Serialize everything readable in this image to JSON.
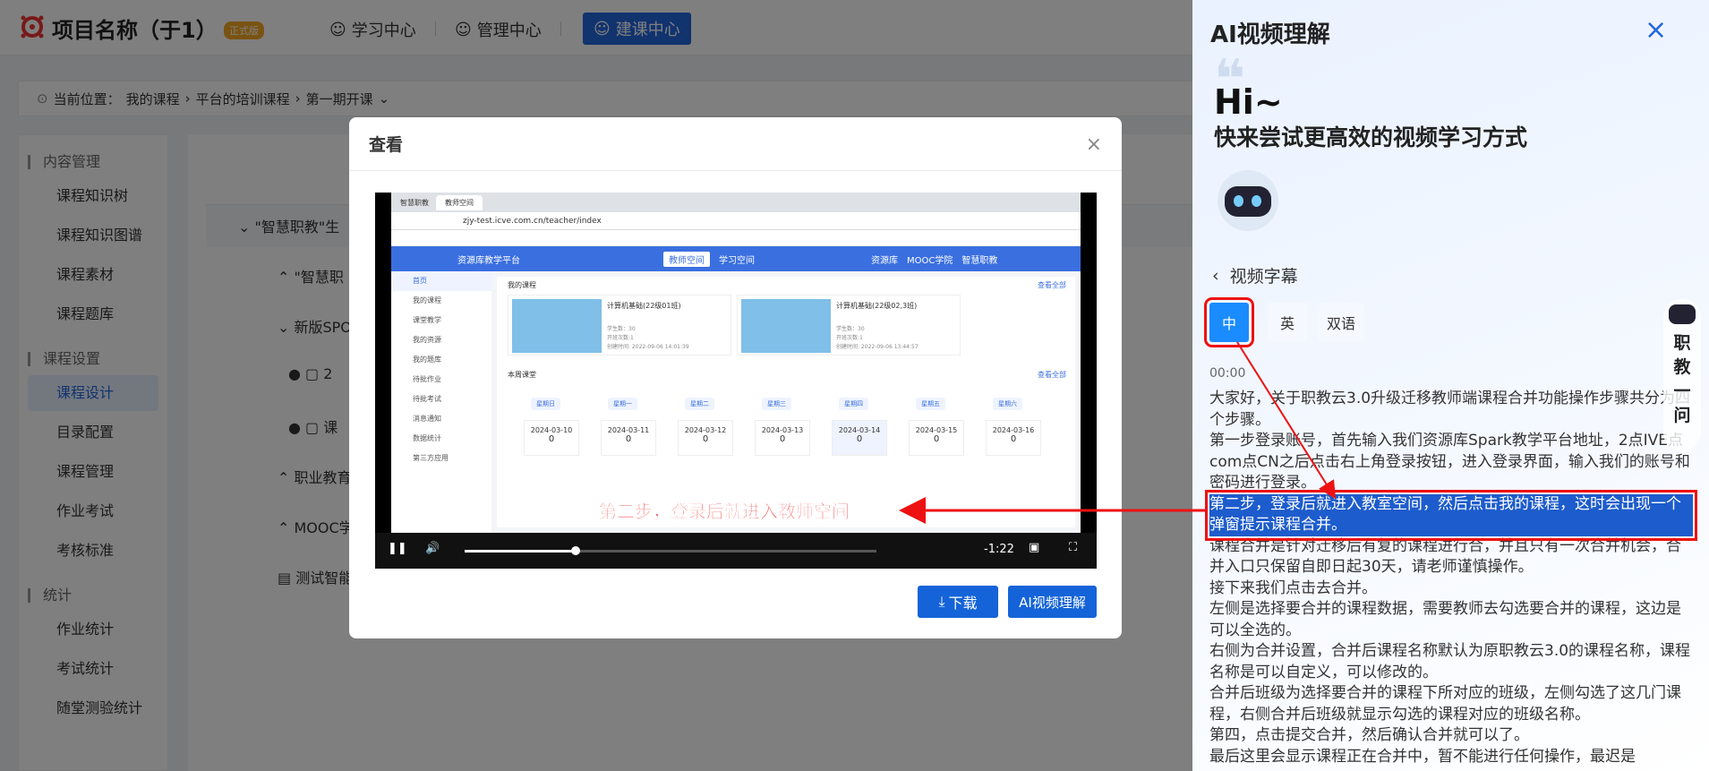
{
  "header": {
    "project_title": "项目名称（于1）",
    "badge": "正式版",
    "nav": [
      "学习中心",
      "管理中心",
      "建课中心"
    ]
  },
  "breadcrumb": {
    "prefix": "当前位置：",
    "items": [
      "我的课程",
      "平台的培训课程",
      "第一期开课"
    ]
  },
  "sidebar": {
    "groups": [
      {
        "title": "内容管理",
        "items": [
          "课程知识树",
          "课程知识图谱",
          "课程素材",
          "课程题库"
        ]
      },
      {
        "title": "课程设置",
        "items": [
          "课程设计",
          "目录配置",
          "课程管理",
          "作业考试",
          "考核标准"
        ]
      },
      {
        "title": "统计",
        "items": [
          "作业统计",
          "考试统计",
          "随堂测验统计"
        ]
      }
    ],
    "active": "课程设计"
  },
  "tree": {
    "rows": [
      "\"智慧职教\"生",
      "\"智慧职",
      "新版SPO",
      "2",
      "课",
      "职业教育",
      "MOOC学",
      "测试智能"
    ]
  },
  "modal": {
    "title": "查看",
    "close": "×",
    "video": {
      "browser_tabs": [
        "智慧职教",
        "教师空间"
      ],
      "url": "zjy-test.icve.com.cn/teacher/index",
      "app_name": "资源库教学平台",
      "app_nav": [
        "教师空间",
        "学习空间",
        "资源库",
        "MOOC学院",
        "智慧职教"
      ],
      "side_menu": [
        "首页",
        "我的课程",
        "课堂教学",
        "我的资源",
        "我的题库",
        "待批作业",
        "待批考试",
        "消息通知",
        "数据统计",
        "第三方应用"
      ],
      "my_courses_label": "我的课程",
      "view_all": "查看全部",
      "courses": [
        {
          "name": "计算机基础(22级01班)",
          "students": "学生数：30",
          "class": "开班次数:1",
          "created": "创建时间: 2022-09-06 14:01:39"
        },
        {
          "name": "计算机基础(22级02,3班)",
          "students": "学生数：30",
          "class": "开班次数:1",
          "created": "创建时间: 2022-09-06 13:44:57"
        }
      ],
      "week_label": "本周课堂",
      "weekdays": [
        "星期日",
        "星期一",
        "星期二",
        "星期三",
        "星期四",
        "星期五",
        "星期六"
      ],
      "dates": [
        "2024-03-10",
        "2024-03-11",
        "2024-03-12",
        "2024-03-13",
        "2024-03-14",
        "2024-03-15",
        "2024-03-16"
      ],
      "counts": [
        "0",
        "0",
        "0",
        "0",
        "0",
        "0",
        "0"
      ],
      "subtitle": "第二步，登录后就进入教师空间",
      "time_remaining": "-1:22",
      "progress": 0.27
    },
    "download_button": "下载",
    "ai_button": "AI视频理解"
  },
  "ai_panel": {
    "title": "AI视频理解",
    "close": "×",
    "greeting": "Hi~",
    "greeting_sub": "快来尝试更高效的视频学习方式",
    "section": "视频字幕",
    "languages": [
      "中",
      "英",
      "双语"
    ],
    "active_language": "中",
    "timestamp": "00:00",
    "paragraphs": [
      "大家好，关于职教云3.0升级迁移教师端课程合并功能操作步骤共分为四个步骤。",
      "第一步登录账号，首先输入我们资源库Spark教学平台地址，2点IVE点com点CN之后点击右上角登录按钮，进入登录界面，输入我们的账号和密码进行登录。",
      "第二步，登录后就进入教室空间，然后点击我的课程，这时会出现一个弹窗提示课程合并。",
      "课程合并是针对迁移后有复的课程进行合，并且只有一次合并机会，合并入口只保留自即日起30天，请老师谨慎操作。",
      "接下来我们点击去合并。",
      "左侧是选择要合并的课程数据，需要教师去勾选要合并的课程，这边是可以全选的。",
      "右侧为合并设置，合并后课程名称默认为原职教云3.0的课程名称，课程名称是可以自定义，可以修改的。",
      "合并后班级为选择要合并的课程下所对应的班级，左侧勾选了这几门课程，右侧合并后班级就显示勾选的课程对应的班级名称。",
      "第四，点击提交合并，然后确认合并就可以了。",
      "最后这里会显示课程正在合并中，暂不能进行任何操作，最迟是"
    ],
    "highlighted_index": 2,
    "side_float": [
      "职",
      "教",
      "一",
      "问"
    ]
  }
}
